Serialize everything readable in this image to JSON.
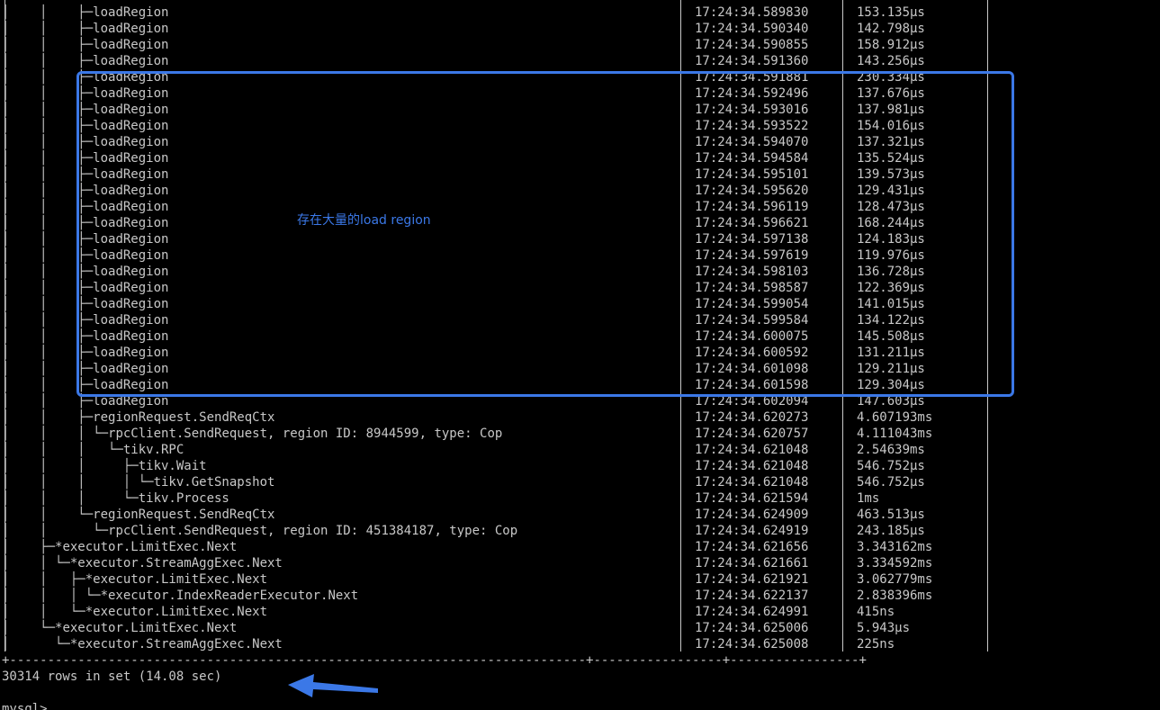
{
  "terminal": {
    "rows": [
      {
        "tree": "│    │    ├─",
        "op": "loadRegion",
        "time": "17:24:34.589830",
        "dur": "153.135µs"
      },
      {
        "tree": "│    │    ├─",
        "op": "loadRegion",
        "time": "17:24:34.590340",
        "dur": "142.798µs"
      },
      {
        "tree": "│    │    ├─",
        "op": "loadRegion",
        "time": "17:24:34.590855",
        "dur": "158.912µs"
      },
      {
        "tree": "│    │    ├─",
        "op": "loadRegion",
        "time": "17:24:34.591360",
        "dur": "143.256µs"
      },
      {
        "tree": "│    │    ├─",
        "op": "loadRegion",
        "time": "17:24:34.591881",
        "dur": "230.334µs"
      },
      {
        "tree": "│    │    ├─",
        "op": "loadRegion",
        "time": "17:24:34.592496",
        "dur": "137.676µs"
      },
      {
        "tree": "│    │    ├─",
        "op": "loadRegion",
        "time": "17:24:34.593016",
        "dur": "137.981µs"
      },
      {
        "tree": "│    │    ├─",
        "op": "loadRegion",
        "time": "17:24:34.593522",
        "dur": "154.016µs"
      },
      {
        "tree": "│    │    ├─",
        "op": "loadRegion",
        "time": "17:24:34.594070",
        "dur": "137.321µs"
      },
      {
        "tree": "│    │    ├─",
        "op": "loadRegion",
        "time": "17:24:34.594584",
        "dur": "135.524µs"
      },
      {
        "tree": "│    │    ├─",
        "op": "loadRegion",
        "time": "17:24:34.595101",
        "dur": "139.573µs"
      },
      {
        "tree": "│    │    ├─",
        "op": "loadRegion",
        "time": "17:24:34.595620",
        "dur": "129.431µs"
      },
      {
        "tree": "│    │    ├─",
        "op": "loadRegion",
        "time": "17:24:34.596119",
        "dur": "128.473µs"
      },
      {
        "tree": "│    │    ├─",
        "op": "loadRegion",
        "time": "17:24:34.596621",
        "dur": "168.244µs"
      },
      {
        "tree": "│    │    ├─",
        "op": "loadRegion",
        "time": "17:24:34.597138",
        "dur": "124.183µs"
      },
      {
        "tree": "│    │    ├─",
        "op": "loadRegion",
        "time": "17:24:34.597619",
        "dur": "119.976µs"
      },
      {
        "tree": "│    │    ├─",
        "op": "loadRegion",
        "time": "17:24:34.598103",
        "dur": "136.728µs"
      },
      {
        "tree": "│    │    ├─",
        "op": "loadRegion",
        "time": "17:24:34.598587",
        "dur": "122.369µs"
      },
      {
        "tree": "│    │    ├─",
        "op": "loadRegion",
        "time": "17:24:34.599054",
        "dur": "141.015µs"
      },
      {
        "tree": "│    │    ├─",
        "op": "loadRegion",
        "time": "17:24:34.599584",
        "dur": "134.122µs"
      },
      {
        "tree": "│    │    ├─",
        "op": "loadRegion",
        "time": "17:24:34.600075",
        "dur": "145.508µs"
      },
      {
        "tree": "│    │    ├─",
        "op": "loadRegion",
        "time": "17:24:34.600592",
        "dur": "131.211µs"
      },
      {
        "tree": "│    │    ├─",
        "op": "loadRegion",
        "time": "17:24:34.601098",
        "dur": "129.211µs"
      },
      {
        "tree": "│    │    ├─",
        "op": "loadRegion",
        "time": "17:24:34.601598",
        "dur": "129.304µs"
      },
      {
        "tree": "│    │    ├─",
        "op": "loadRegion",
        "time": "17:24:34.602094",
        "dur": "147.603µs"
      },
      {
        "tree": "│    │    ├─",
        "op": "regionRequest.SendReqCtx",
        "time": "17:24:34.620273",
        "dur": "4.607193ms"
      },
      {
        "tree": "│    │    │ └─",
        "op": "rpcClient.SendRequest, region ID: 8944599, type: Cop",
        "time": "17:24:34.620757",
        "dur": "4.111043ms"
      },
      {
        "tree": "│    │    │   └─",
        "op": "tikv.RPC",
        "time": "17:24:34.621048",
        "dur": "2.54639ms"
      },
      {
        "tree": "│    │    │     ├─",
        "op": "tikv.Wait",
        "time": "17:24:34.621048",
        "dur": "546.752µs"
      },
      {
        "tree": "│    │    │     │ └─",
        "op": "tikv.GetSnapshot",
        "time": "17:24:34.621048",
        "dur": "546.752µs"
      },
      {
        "tree": "│    │    │     └─",
        "op": "tikv.Process",
        "time": "17:24:34.621594",
        "dur": "1ms"
      },
      {
        "tree": "│    │    └─",
        "op": "regionRequest.SendReqCtx",
        "time": "17:24:34.624909",
        "dur": "463.513µs"
      },
      {
        "tree": "│    │      └─",
        "op": "rpcClient.SendRequest, region ID: 451384187, type: Cop",
        "time": "17:24:34.624919",
        "dur": "243.185µs"
      },
      {
        "tree": "│    ├─",
        "op": "*executor.LimitExec.Next",
        "time": "17:24:34.621656",
        "dur": "3.343162ms"
      },
      {
        "tree": "│    │ └─",
        "op": "*executor.StreamAggExec.Next",
        "time": "17:24:34.621661",
        "dur": "3.334592ms"
      },
      {
        "tree": "│    │   ├─",
        "op": "*executor.LimitExec.Next",
        "time": "17:24:34.621921",
        "dur": "3.062779ms"
      },
      {
        "tree": "│    │   │ └─",
        "op": "*executor.IndexReaderExecutor.Next",
        "time": "17:24:34.622137",
        "dur": "2.838396ms"
      },
      {
        "tree": "│    │   └─",
        "op": "*executor.LimitExec.Next",
        "time": "17:24:34.624991",
        "dur": "415ns"
      },
      {
        "tree": "│    └─",
        "op": "*executor.LimitExec.Next",
        "time": "17:24:34.625006",
        "dur": "5.943µs"
      },
      {
        "tree": "│      └─",
        "op": "*executor.StreamAggExec.Next",
        "time": "17:24:34.625008",
        "dur": "225ns"
      }
    ],
    "separator": "+----------------------------------------------------------------------------+-----------------+-----------------+",
    "result_line": "30314 rows in set (14.08 sec)",
    "prompt": "mysql>"
  },
  "annotation": {
    "text": "存在大量的load region",
    "color": "#3b78e7"
  },
  "colors": {
    "background": "#000000",
    "text": "#c8c8c8",
    "accent": "#3b78e7"
  }
}
